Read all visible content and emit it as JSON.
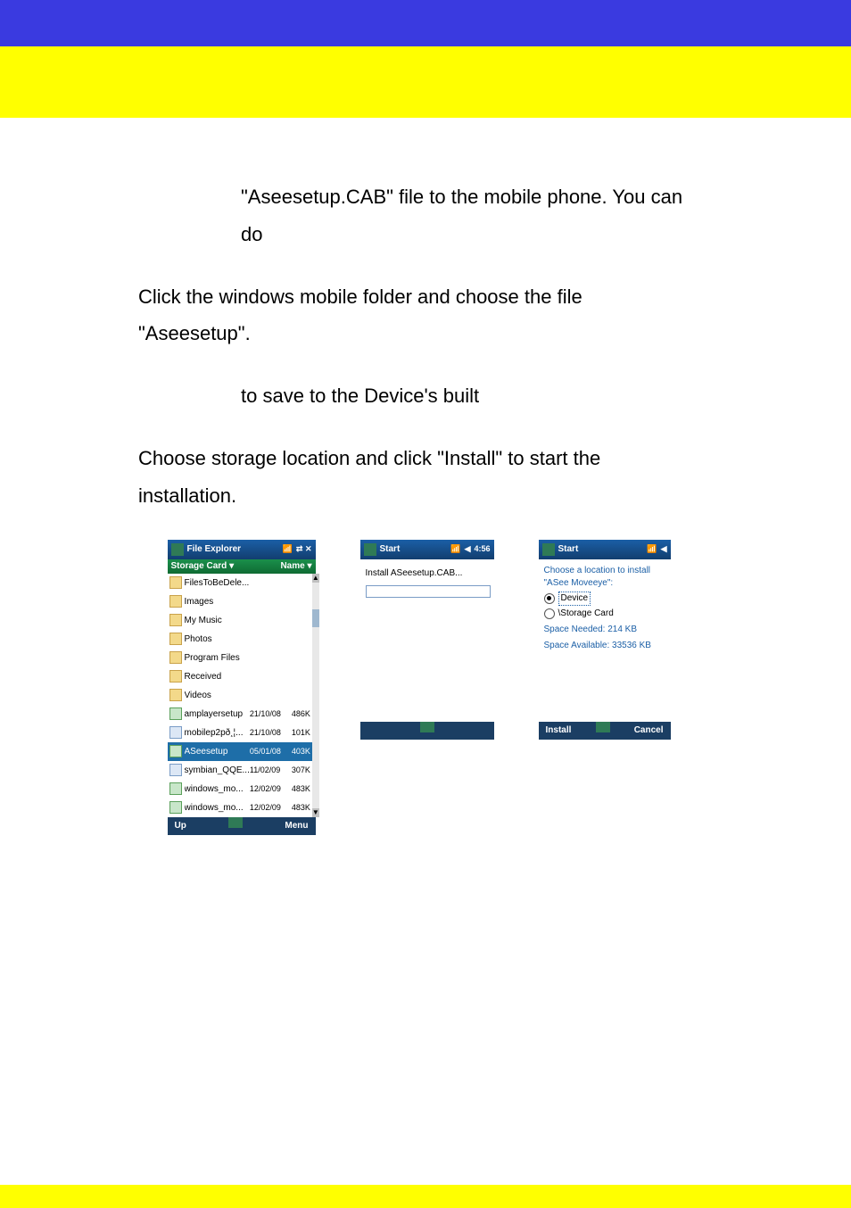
{
  "para1": "\"Aseesetup.CAB\" file to the mobile phone. You can do",
  "para2": "Click the windows mobile folder and choose the file \"Aseesetup\".",
  "para3": "to save to the Device's built",
  "para4": "Choose storage location and click \"Install\" to start the installation.",
  "phone1": {
    "title": "File Explorer",
    "status": "⇄ ✕",
    "path_left": "Storage Card ▾",
    "path_right": "Name ▾",
    "rows": [
      {
        "icon": "folder",
        "name": "FilesToBeDele...",
        "date": "",
        "size": ""
      },
      {
        "icon": "folder",
        "name": "Images",
        "date": "",
        "size": ""
      },
      {
        "icon": "folder",
        "name": "My Music",
        "date": "",
        "size": ""
      },
      {
        "icon": "folder",
        "name": "Photos",
        "date": "",
        "size": ""
      },
      {
        "icon": "folder",
        "name": "Program Files",
        "date": "",
        "size": ""
      },
      {
        "icon": "folder",
        "name": "Received",
        "date": "",
        "size": ""
      },
      {
        "icon": "folder",
        "name": "Videos",
        "date": "",
        "size": ""
      },
      {
        "icon": "exe",
        "name": "amplayersetup",
        "date": "21/10/08",
        "size": "486K"
      },
      {
        "icon": "file",
        "name": "mobilep2pð¸¦...",
        "date": "21/10/08",
        "size": "101K"
      },
      {
        "icon": "exe",
        "name": "ASeesetup",
        "date": "05/01/08",
        "size": "403K",
        "selected": true
      },
      {
        "icon": "file",
        "name": "symbian_QQE...",
        "date": "11/02/09",
        "size": "307K"
      },
      {
        "icon": "exe",
        "name": "windows_mo...",
        "date": "12/02/09",
        "size": "483K"
      },
      {
        "icon": "exe",
        "name": "windows_mo...",
        "date": "12/02/09",
        "size": "483K"
      }
    ],
    "footer_left": "Up",
    "footer_right": "Menu"
  },
  "phone2": {
    "title": "Start",
    "time": "4:56",
    "message": "Install ASeesetup.CAB..."
  },
  "phone3": {
    "title": "Start",
    "prompt": "Choose a location to install \"ASee Moveeye\":",
    "opt1": "Device",
    "opt2": "\\Storage Card",
    "info1": "Space Needed: 214 KB",
    "info2": "Space Available: 33536 KB",
    "footer_left": "Install",
    "footer_right": "Cancel"
  }
}
